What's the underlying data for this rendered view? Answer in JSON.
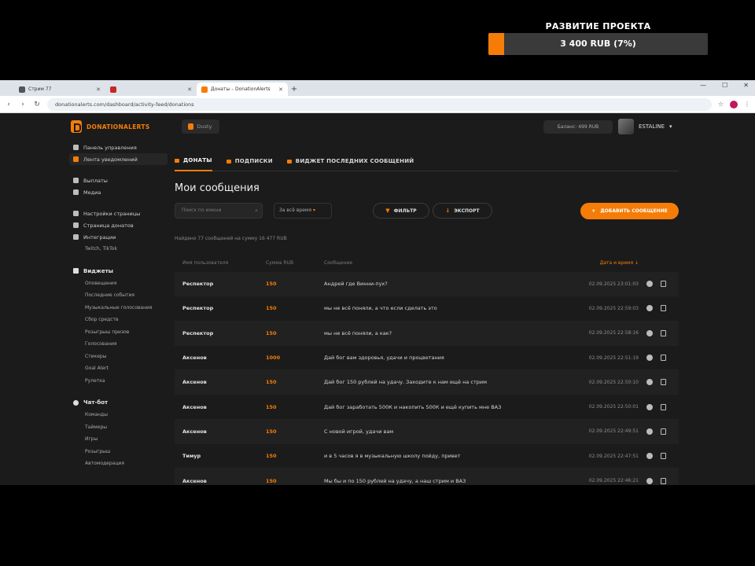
{
  "overlay": {
    "title": "РАЗВИТИЕ ПРОЕКТА",
    "progress_text": "3 400 RUB (7%)",
    "progress_fraction": 0.07,
    "accent": "#f57d07"
  },
  "browser": {
    "tabs": [
      {
        "title": "Стрим 77",
        "active": false
      },
      {
        "title": "",
        "active": false
      },
      {
        "title": "Донаты – DonationAlerts",
        "active": true
      }
    ],
    "new_tab": "+",
    "url": "donationalerts.com/dashboard/activity-feed/donations"
  },
  "app": {
    "logo_text": "DONATIONALERTS",
    "channel": "Dusty",
    "balance": "Баланс: 499 RUB",
    "username": "ESTALINE"
  },
  "sidebar": {
    "top_items": [
      {
        "label": "Панель управления",
        "active": false
      },
      {
        "label": "Лента уведомлений",
        "active": true
      }
    ],
    "group2": [
      {
        "label": "Выплаты"
      },
      {
        "label": "Медиа"
      }
    ],
    "group3": [
      {
        "label": "Настройки страницы"
      },
      {
        "label": "Страница донатов"
      },
      {
        "label": "Интеграции"
      }
    ],
    "sub_item": "Twitch, TikTok",
    "widgets_head": "Виджеты",
    "widgets": [
      "Оповещения",
      "Последние события",
      "Музыкальные голосования",
      "Сбор средств",
      "Розыгрыш призов",
      "Голосования",
      "Стикеры",
      "Goal Alert",
      "Рулетка"
    ],
    "bot_head": "Чат-бот",
    "bot_items": [
      "Команды",
      "Таймеры",
      "Игры",
      "Розыгрыш",
      "Автомодерация"
    ]
  },
  "main": {
    "tabs": [
      "ДОНАТЫ",
      "ПОДПИСКИ",
      "ВИДЖЕТ ПОСЛЕДНИХ СООБЩЕНИЙ"
    ],
    "title": "Мои сообщения",
    "search_placeholder": "Поиск по имени",
    "sort_label": "За всё время",
    "filter_label": "ФИЛЬТР",
    "export_label": "ЭКСПОРТ",
    "add_label": "ДОБАВИТЬ СООБЩЕНИЕ",
    "found_text": "Найдено 77 сообщений на сумму 16 477 RUB",
    "columns": {
      "name": "Имя пользователя",
      "sum": "Сумма RUB",
      "message": "Сообщение",
      "date": "Дата и время"
    },
    "rows": [
      {
        "name": "Респектор",
        "sum": "150",
        "message": "Андрей где Винни-пух?",
        "date": "02.09.2025 23:01:03"
      },
      {
        "name": "Респектор",
        "sum": "150",
        "message": "мы не всё поняли, а что если сделать это",
        "date": "02.09.2025 22:59:03"
      },
      {
        "name": "Респектор",
        "sum": "150",
        "message": "мы не всё поняли, а как?",
        "date": "02.09.2025 22:58:16"
      },
      {
        "name": "Аксенов",
        "sum": "1000",
        "message": "Дай бог вам здоровья, удачи и процветания",
        "date": "02.09.2025 22:51:19"
      },
      {
        "name": "Аксенов",
        "sum": "150",
        "message": "Дай бог 150 рублей на удачу. Заходите к нам ещё на стрим",
        "date": "02.09.2025 22:50:10"
      },
      {
        "name": "Аксенов",
        "sum": "150",
        "message": "Дай бог заработать 500К и накопить 500К и ещё купить мне ВАЗ",
        "date": "02.09.2025 22:50:01"
      },
      {
        "name": "Аксенов",
        "sum": "150",
        "message": "С новой игрой, удачи вам",
        "date": "02.09.2025 22:49:51"
      },
      {
        "name": "Тимур",
        "sum": "150",
        "message": "и в 5 часов я в музыкальную школу пойду, привет",
        "date": "02.09.2025 22:47:51"
      },
      {
        "name": "Аксенов",
        "sum": "150",
        "message": "Мы бы и по 150 рублей на удачу, а наш стрим и ВАЗ",
        "date": "02.09.2025 22:46:21"
      }
    ]
  }
}
